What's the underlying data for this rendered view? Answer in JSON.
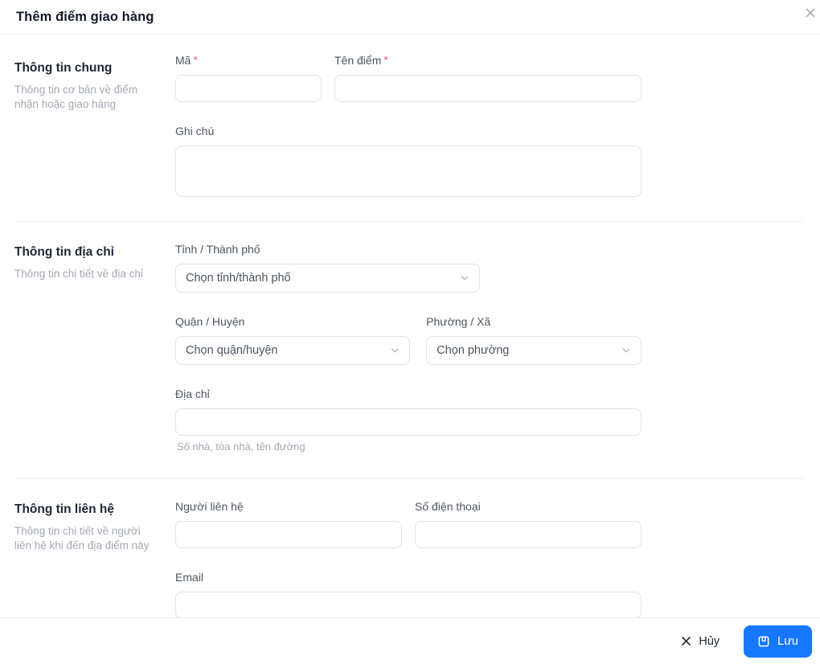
{
  "dialog": {
    "title": "Thêm điểm giao hàng",
    "required_mark": "*"
  },
  "sections": {
    "general": {
      "title": "Thông tin chung",
      "description": "Thông tin cơ bản về điểm nhận hoặc giao hàng",
      "fields": {
        "code": {
          "label": "Mã",
          "value": "",
          "placeholder": ""
        },
        "name": {
          "label": "Tên điểm",
          "value": "",
          "placeholder": ""
        },
        "note": {
          "label": "Ghi chú",
          "value": "",
          "placeholder": ""
        }
      }
    },
    "address": {
      "title": "Thông tin địa chỉ",
      "description": "Thông tin chi tiết về địa chỉ",
      "fields": {
        "province": {
          "label": "Tỉnh / Thành phố",
          "placeholder": "Chọn tỉnh/thành phố"
        },
        "district": {
          "label": "Quận / Huyện",
          "placeholder": "Chọn quận/huyện"
        },
        "ward": {
          "label": "Phường / Xã",
          "placeholder": "Chọn phường"
        },
        "street": {
          "label": "Địa chỉ",
          "value": "",
          "placeholder": "",
          "hint": "Số nhà, tòa nhà, tên đường"
        }
      }
    },
    "contact": {
      "title": "Thông tin liên hệ",
      "description": "Thông tin chi tiết về người liên hệ khi đến địa điểm này",
      "fields": {
        "person": {
          "label": "Người liên hệ",
          "value": "",
          "placeholder": ""
        },
        "phone": {
          "label": "Số điện thoại",
          "value": "",
          "placeholder": ""
        },
        "email": {
          "label": "Email",
          "value": "",
          "placeholder": ""
        }
      }
    }
  },
  "footer": {
    "cancel_label": "Hủy",
    "save_label": "Lưu"
  },
  "icons": {
    "header_close": "close-icon",
    "cancel": "close-icon",
    "save": "floppy-disk-icon",
    "select": "chevron-down-icon"
  },
  "colors": {
    "primary_button": "#1677ff",
    "required_asterisk": "#f5426c",
    "label_text": "#4c5562",
    "muted_text": "#a3a9b3",
    "input_border": "#e0e3e8",
    "divider": "#ededed"
  }
}
